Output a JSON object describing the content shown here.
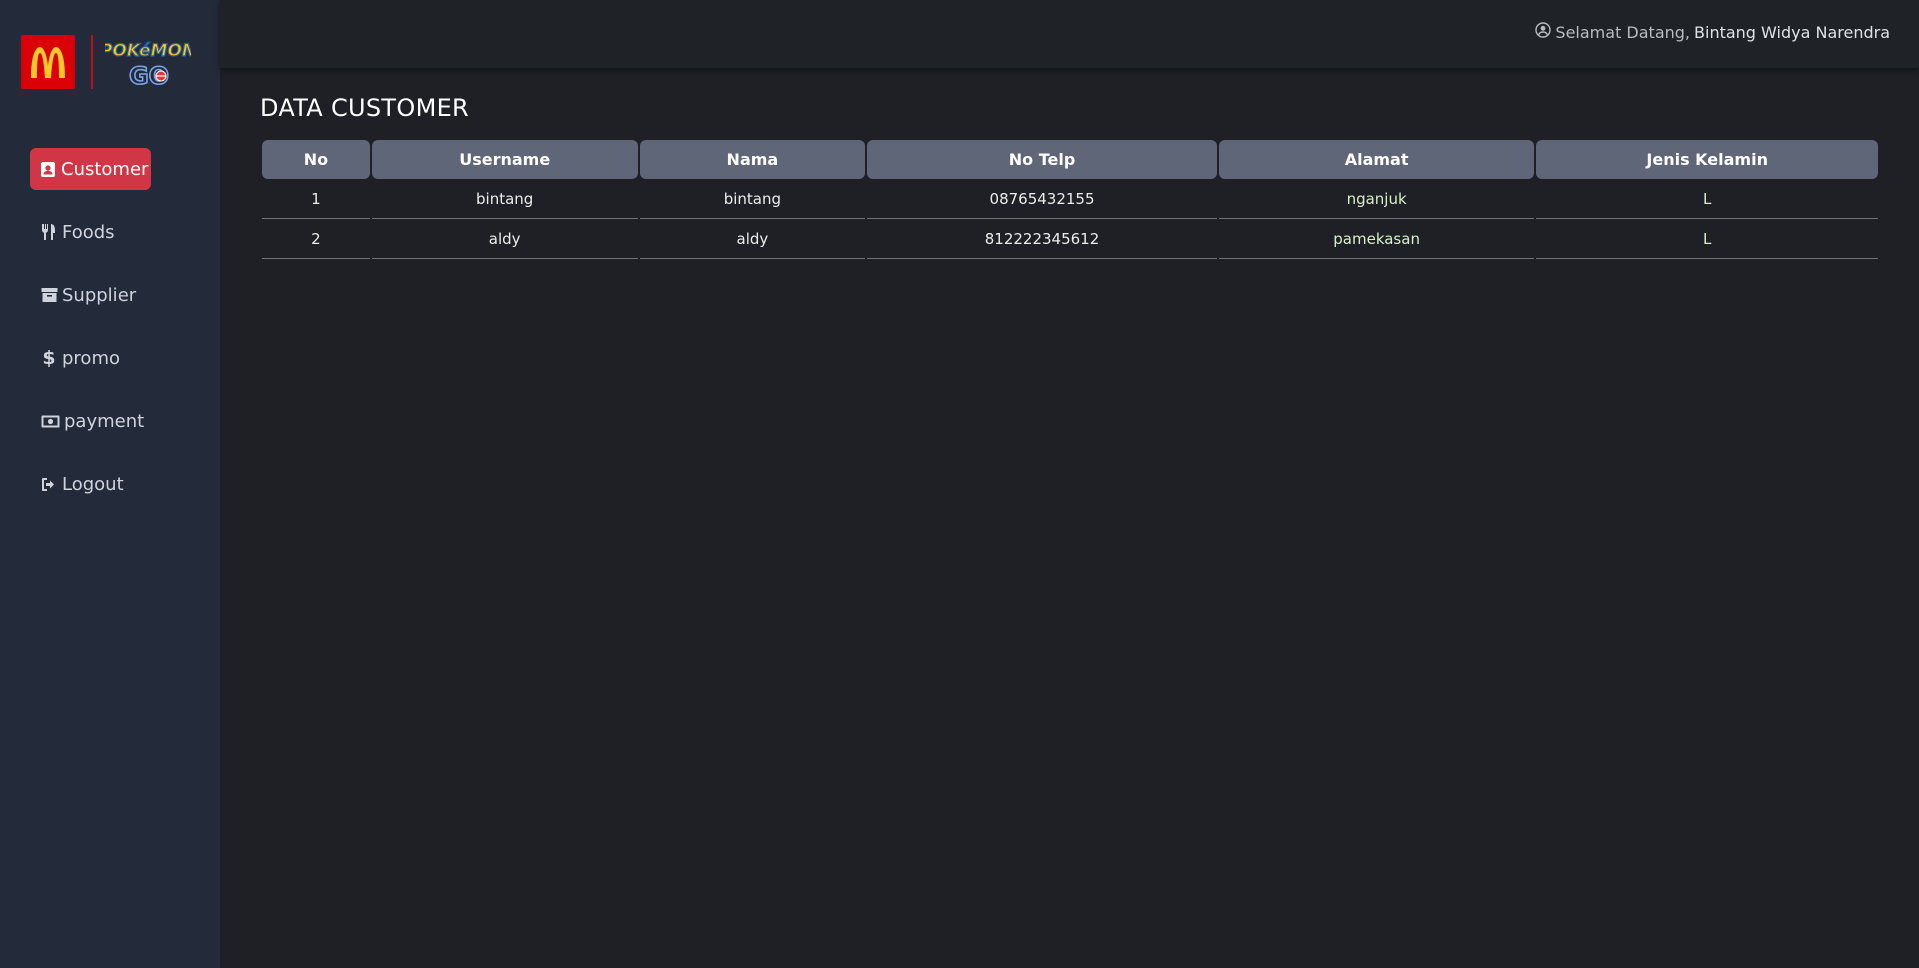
{
  "brand": {
    "logo_mcd": "mcdonalds-logo",
    "logo_pogo": "pokemon-go-logo",
    "mcd_color": "#d90007"
  },
  "sidebar": {
    "items": [
      {
        "label": "Customer",
        "icon": "contact-card-icon",
        "active": true
      },
      {
        "label": "Foods",
        "icon": "utensils-icon"
      },
      {
        "label": "Supplier",
        "icon": "archive-box-icon"
      },
      {
        "label": "promo",
        "icon": "dollar-icon"
      },
      {
        "label": "payment",
        "icon": "money-bill-icon"
      },
      {
        "label": "Logout",
        "icon": "sign-out-icon"
      }
    ],
    "active_color": "#d03646"
  },
  "header": {
    "greeting": "Selamat Datang,",
    "user_name": "Bintang Widya Narendra",
    "icon": "user-circle-icon"
  },
  "main": {
    "title": "DATA CUSTOMER",
    "table": {
      "columns": [
        "No",
        "Username",
        "Nama",
        "No Telp",
        "Alamat",
        "Jenis Kelamin"
      ],
      "rows": [
        [
          "1",
          "bintang",
          "bintang",
          "08765432155",
          "nganjuk",
          "L"
        ],
        [
          "2",
          "aldy",
          "aldy",
          "812222345612",
          "pamekasan",
          "L"
        ]
      ]
    }
  }
}
